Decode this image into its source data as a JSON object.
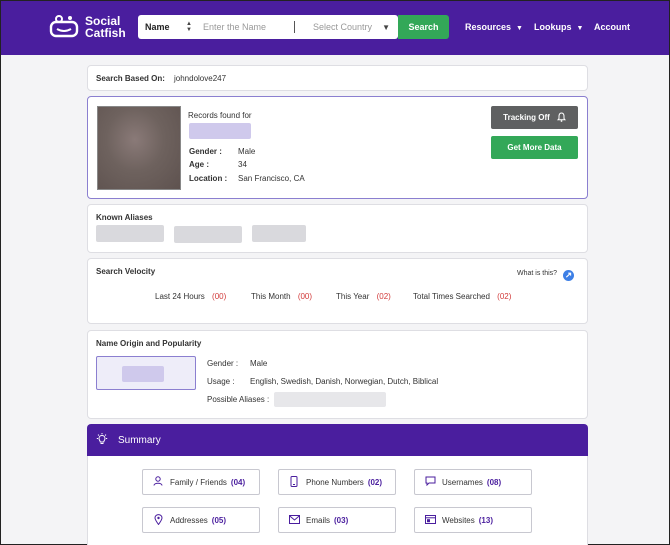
{
  "header": {
    "logo_line1": "Social",
    "logo_line2": "Catfish",
    "search_type": "Name",
    "search_placeholder": "Enter the Name",
    "country_placeholder": "Select Country",
    "search_button": "Search",
    "nav": [
      "Resources",
      "Lookups",
      "Account"
    ]
  },
  "search_based": {
    "label": "Search Based On:",
    "value": "johndolove247"
  },
  "profile": {
    "records_label": "Records found for",
    "gender_label": "Gender :",
    "gender": "Male",
    "age_label": "Age :",
    "age": "34",
    "location_label": "Location :",
    "location": "San Francisco, CA",
    "tracking_button": "Tracking Off",
    "get_more_button": "Get More Data"
  },
  "aliases": {
    "title": "Known Aliases"
  },
  "velocity": {
    "title": "Search Velocity",
    "help": "What is this?",
    "items": [
      {
        "label": "Last 24 Hours",
        "count": "(00)"
      },
      {
        "label": "This Month",
        "count": "(00)"
      },
      {
        "label": "This Year",
        "count": "(02)"
      },
      {
        "label": "Total Times Searched",
        "count": "(02)"
      }
    ]
  },
  "origin": {
    "title": "Name Origin and Popularity",
    "gender_label": "Gender :",
    "gender": "Male",
    "usage_label": "Usage :",
    "usage": "English, Swedish, Danish, Norwegian, Dutch, Biblical",
    "aliases_label": "Possible Aliases :"
  },
  "summary": {
    "title": "Summary",
    "items": [
      {
        "label": "Family / Friends",
        "count": "(04)",
        "icon": "person-icon"
      },
      {
        "label": "Phone Numbers",
        "count": "(02)",
        "icon": "phone-icon"
      },
      {
        "label": "Usernames",
        "count": "(08)",
        "icon": "chat-icon"
      },
      {
        "label": "Addresses",
        "count": "(05)",
        "icon": "location-pin-icon"
      },
      {
        "label": "Emails",
        "count": "(03)",
        "icon": "envelope-icon"
      },
      {
        "label": "Websites",
        "count": "(13)",
        "icon": "browser-icon"
      }
    ]
  },
  "colors": {
    "brand_purple": "#4a1e9e",
    "green": "#33a858",
    "count_red": "#d23a3a"
  }
}
